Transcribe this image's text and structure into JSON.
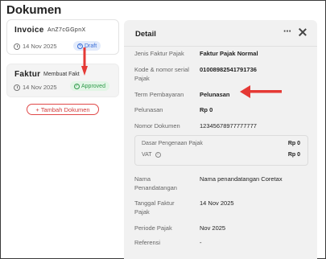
{
  "page": {
    "title": "Dokumen"
  },
  "documents": [
    {
      "title": "Invoice",
      "subtitle": "AnZ7cGGpnX",
      "date": "14 Nov 2025",
      "status": "Draft"
    },
    {
      "title": "Faktur",
      "subtitle": "Membuat Fakt",
      "date": "14 Nov 2025",
      "status": "Approved"
    }
  ],
  "add_button": {
    "label": "+ Tambah Dokumen"
  },
  "detail": {
    "title": "Detail",
    "more_icon": "⋯",
    "rows": [
      {
        "label": "Jenis Faktur Pajak",
        "value": "Faktur Pajak Normal"
      },
      {
        "label": "Kode & nomor serial Pajak",
        "value": "01008982541791736"
      },
      {
        "label": "Term Pembayaran",
        "value": "Pelunasan"
      },
      {
        "label": "Pelunasan",
        "value": "Rp 0"
      },
      {
        "label": "Nomor Dokumen",
        "value": "12345678977777777"
      }
    ],
    "tax_box": {
      "dpp_label": "Dasar Pengenaan Pajak",
      "dpp_value": "Rp 0",
      "vat_label": "VAT",
      "vat_value": "Rp 0"
    },
    "rows2": [
      {
        "label": "Nama Penandatangan",
        "value": "Nama penandatangan Coretax"
      },
      {
        "label": "Tanggal Faktur Pajak",
        "value": "14 Nov 2025"
      },
      {
        "label": "Periode Pajak",
        "value": "Nov 2025"
      },
      {
        "label": "Referensi",
        "value": "-"
      }
    ]
  },
  "colors": {
    "annotation_arrow": "#e53935",
    "draft": "#3b6fd8",
    "approved": "#2f9a4a"
  }
}
